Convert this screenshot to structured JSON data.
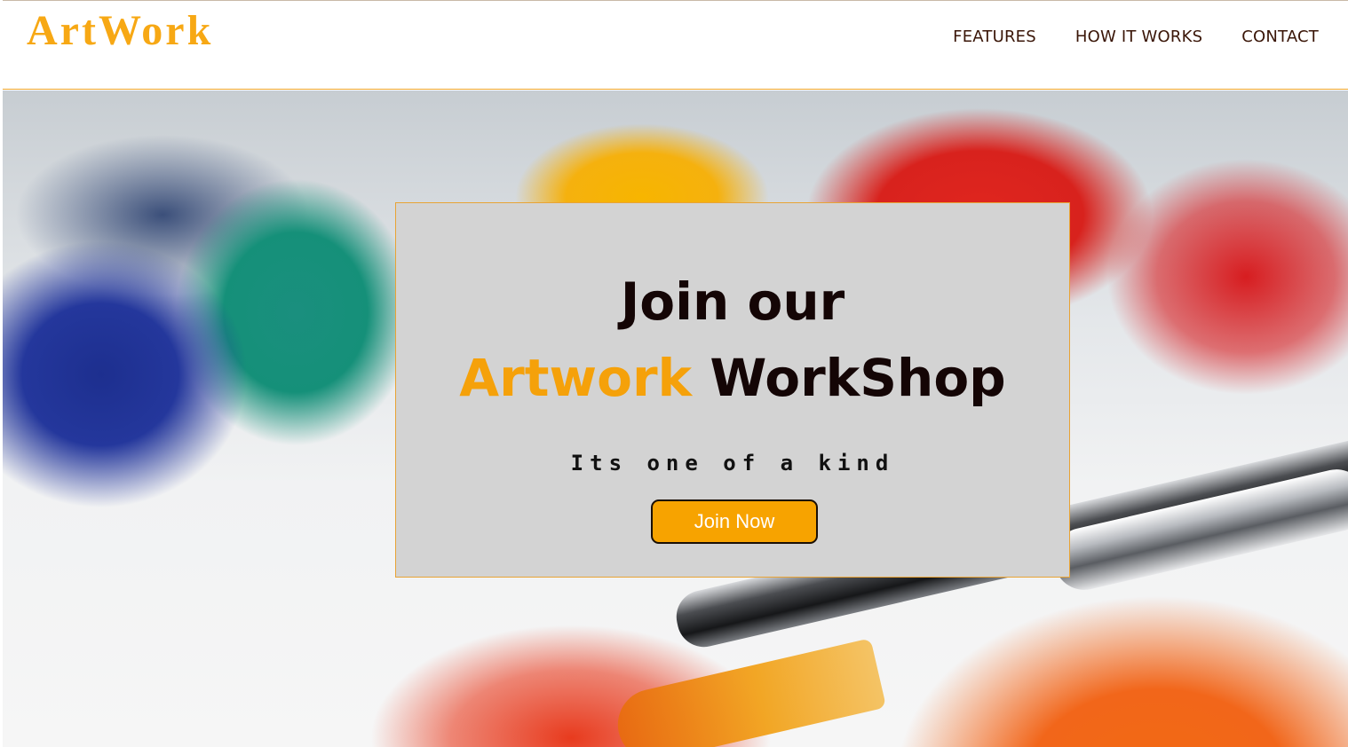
{
  "brand": {
    "name": "ArtWork"
  },
  "nav": {
    "items": [
      {
        "label": "FEATURES"
      },
      {
        "label": "HOW IT WORKS"
      },
      {
        "label": "CONTACT"
      }
    ]
  },
  "hero": {
    "title_line1": "Join our",
    "title_accent": "Artwork",
    "title_rest": "WorkShop",
    "subtitle": "Its one of a kind",
    "cta_label": "Join Now"
  },
  "colors": {
    "accent": "#f7a300",
    "nav_text": "#3a1608",
    "card_bg": "#d3d3d3"
  }
}
